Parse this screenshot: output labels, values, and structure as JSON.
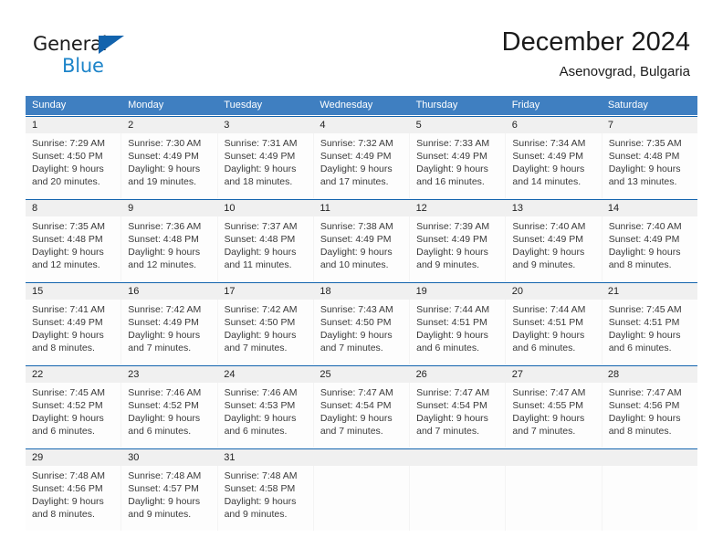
{
  "brand": {
    "name_top": "General",
    "name_bottom": "Blue",
    "accent_color": "#1263ad",
    "blue_text_color": "#1d84c9"
  },
  "header": {
    "title": "December 2024",
    "subtitle": "Asenovgrad, Bulgaria"
  },
  "calendar": {
    "header_bg": "#3f7fc1",
    "daynum_bg": "#f0f0f0",
    "row_rule_color": "#1263ad",
    "weekdays": [
      "Sunday",
      "Monday",
      "Tuesday",
      "Wednesday",
      "Thursday",
      "Friday",
      "Saturday"
    ],
    "weeks": [
      [
        {
          "day": "1",
          "sunrise": "Sunrise: 7:29 AM",
          "sunset": "Sunset: 4:50 PM",
          "daylight1": "Daylight: 9 hours",
          "daylight2": "and 20 minutes."
        },
        {
          "day": "2",
          "sunrise": "Sunrise: 7:30 AM",
          "sunset": "Sunset: 4:49 PM",
          "daylight1": "Daylight: 9 hours",
          "daylight2": "and 19 minutes."
        },
        {
          "day": "3",
          "sunrise": "Sunrise: 7:31 AM",
          "sunset": "Sunset: 4:49 PM",
          "daylight1": "Daylight: 9 hours",
          "daylight2": "and 18 minutes."
        },
        {
          "day": "4",
          "sunrise": "Sunrise: 7:32 AM",
          "sunset": "Sunset: 4:49 PM",
          "daylight1": "Daylight: 9 hours",
          "daylight2": "and 17 minutes."
        },
        {
          "day": "5",
          "sunrise": "Sunrise: 7:33 AM",
          "sunset": "Sunset: 4:49 PM",
          "daylight1": "Daylight: 9 hours",
          "daylight2": "and 16 minutes."
        },
        {
          "day": "6",
          "sunrise": "Sunrise: 7:34 AM",
          "sunset": "Sunset: 4:49 PM",
          "daylight1": "Daylight: 9 hours",
          "daylight2": "and 14 minutes."
        },
        {
          "day": "7",
          "sunrise": "Sunrise: 7:35 AM",
          "sunset": "Sunset: 4:48 PM",
          "daylight1": "Daylight: 9 hours",
          "daylight2": "and 13 minutes."
        }
      ],
      [
        {
          "day": "8",
          "sunrise": "Sunrise: 7:35 AM",
          "sunset": "Sunset: 4:48 PM",
          "daylight1": "Daylight: 9 hours",
          "daylight2": "and 12 minutes."
        },
        {
          "day": "9",
          "sunrise": "Sunrise: 7:36 AM",
          "sunset": "Sunset: 4:48 PM",
          "daylight1": "Daylight: 9 hours",
          "daylight2": "and 12 minutes."
        },
        {
          "day": "10",
          "sunrise": "Sunrise: 7:37 AM",
          "sunset": "Sunset: 4:48 PM",
          "daylight1": "Daylight: 9 hours",
          "daylight2": "and 11 minutes."
        },
        {
          "day": "11",
          "sunrise": "Sunrise: 7:38 AM",
          "sunset": "Sunset: 4:49 PM",
          "daylight1": "Daylight: 9 hours",
          "daylight2": "and 10 minutes."
        },
        {
          "day": "12",
          "sunrise": "Sunrise: 7:39 AM",
          "sunset": "Sunset: 4:49 PM",
          "daylight1": "Daylight: 9 hours",
          "daylight2": "and 9 minutes."
        },
        {
          "day": "13",
          "sunrise": "Sunrise: 7:40 AM",
          "sunset": "Sunset: 4:49 PM",
          "daylight1": "Daylight: 9 hours",
          "daylight2": "and 9 minutes."
        },
        {
          "day": "14",
          "sunrise": "Sunrise: 7:40 AM",
          "sunset": "Sunset: 4:49 PM",
          "daylight1": "Daylight: 9 hours",
          "daylight2": "and 8 minutes."
        }
      ],
      [
        {
          "day": "15",
          "sunrise": "Sunrise: 7:41 AM",
          "sunset": "Sunset: 4:49 PM",
          "daylight1": "Daylight: 9 hours",
          "daylight2": "and 8 minutes."
        },
        {
          "day": "16",
          "sunrise": "Sunrise: 7:42 AM",
          "sunset": "Sunset: 4:49 PM",
          "daylight1": "Daylight: 9 hours",
          "daylight2": "and 7 minutes."
        },
        {
          "day": "17",
          "sunrise": "Sunrise: 7:42 AM",
          "sunset": "Sunset: 4:50 PM",
          "daylight1": "Daylight: 9 hours",
          "daylight2": "and 7 minutes."
        },
        {
          "day": "18",
          "sunrise": "Sunrise: 7:43 AM",
          "sunset": "Sunset: 4:50 PM",
          "daylight1": "Daylight: 9 hours",
          "daylight2": "and 7 minutes."
        },
        {
          "day": "19",
          "sunrise": "Sunrise: 7:44 AM",
          "sunset": "Sunset: 4:51 PM",
          "daylight1": "Daylight: 9 hours",
          "daylight2": "and 6 minutes."
        },
        {
          "day": "20",
          "sunrise": "Sunrise: 7:44 AM",
          "sunset": "Sunset: 4:51 PM",
          "daylight1": "Daylight: 9 hours",
          "daylight2": "and 6 minutes."
        },
        {
          "day": "21",
          "sunrise": "Sunrise: 7:45 AM",
          "sunset": "Sunset: 4:51 PM",
          "daylight1": "Daylight: 9 hours",
          "daylight2": "and 6 minutes."
        }
      ],
      [
        {
          "day": "22",
          "sunrise": "Sunrise: 7:45 AM",
          "sunset": "Sunset: 4:52 PM",
          "daylight1": "Daylight: 9 hours",
          "daylight2": "and 6 minutes."
        },
        {
          "day": "23",
          "sunrise": "Sunrise: 7:46 AM",
          "sunset": "Sunset: 4:52 PM",
          "daylight1": "Daylight: 9 hours",
          "daylight2": "and 6 minutes."
        },
        {
          "day": "24",
          "sunrise": "Sunrise: 7:46 AM",
          "sunset": "Sunset: 4:53 PM",
          "daylight1": "Daylight: 9 hours",
          "daylight2": "and 6 minutes."
        },
        {
          "day": "25",
          "sunrise": "Sunrise: 7:47 AM",
          "sunset": "Sunset: 4:54 PM",
          "daylight1": "Daylight: 9 hours",
          "daylight2": "and 7 minutes."
        },
        {
          "day": "26",
          "sunrise": "Sunrise: 7:47 AM",
          "sunset": "Sunset: 4:54 PM",
          "daylight1": "Daylight: 9 hours",
          "daylight2": "and 7 minutes."
        },
        {
          "day": "27",
          "sunrise": "Sunrise: 7:47 AM",
          "sunset": "Sunset: 4:55 PM",
          "daylight1": "Daylight: 9 hours",
          "daylight2": "and 7 minutes."
        },
        {
          "day": "28",
          "sunrise": "Sunrise: 7:47 AM",
          "sunset": "Sunset: 4:56 PM",
          "daylight1": "Daylight: 9 hours",
          "daylight2": "and 8 minutes."
        }
      ],
      [
        {
          "day": "29",
          "sunrise": "Sunrise: 7:48 AM",
          "sunset": "Sunset: 4:56 PM",
          "daylight1": "Daylight: 9 hours",
          "daylight2": "and 8 minutes."
        },
        {
          "day": "30",
          "sunrise": "Sunrise: 7:48 AM",
          "sunset": "Sunset: 4:57 PM",
          "daylight1": "Daylight: 9 hours",
          "daylight2": "and 9 minutes."
        },
        {
          "day": "31",
          "sunrise": "Sunrise: 7:48 AM",
          "sunset": "Sunset: 4:58 PM",
          "daylight1": "Daylight: 9 hours",
          "daylight2": "and 9 minutes."
        },
        {
          "day": "",
          "sunrise": "",
          "sunset": "",
          "daylight1": "",
          "daylight2": ""
        },
        {
          "day": "",
          "sunrise": "",
          "sunset": "",
          "daylight1": "",
          "daylight2": ""
        },
        {
          "day": "",
          "sunrise": "",
          "sunset": "",
          "daylight1": "",
          "daylight2": ""
        },
        {
          "day": "",
          "sunrise": "",
          "sunset": "",
          "daylight1": "",
          "daylight2": ""
        }
      ]
    ]
  }
}
